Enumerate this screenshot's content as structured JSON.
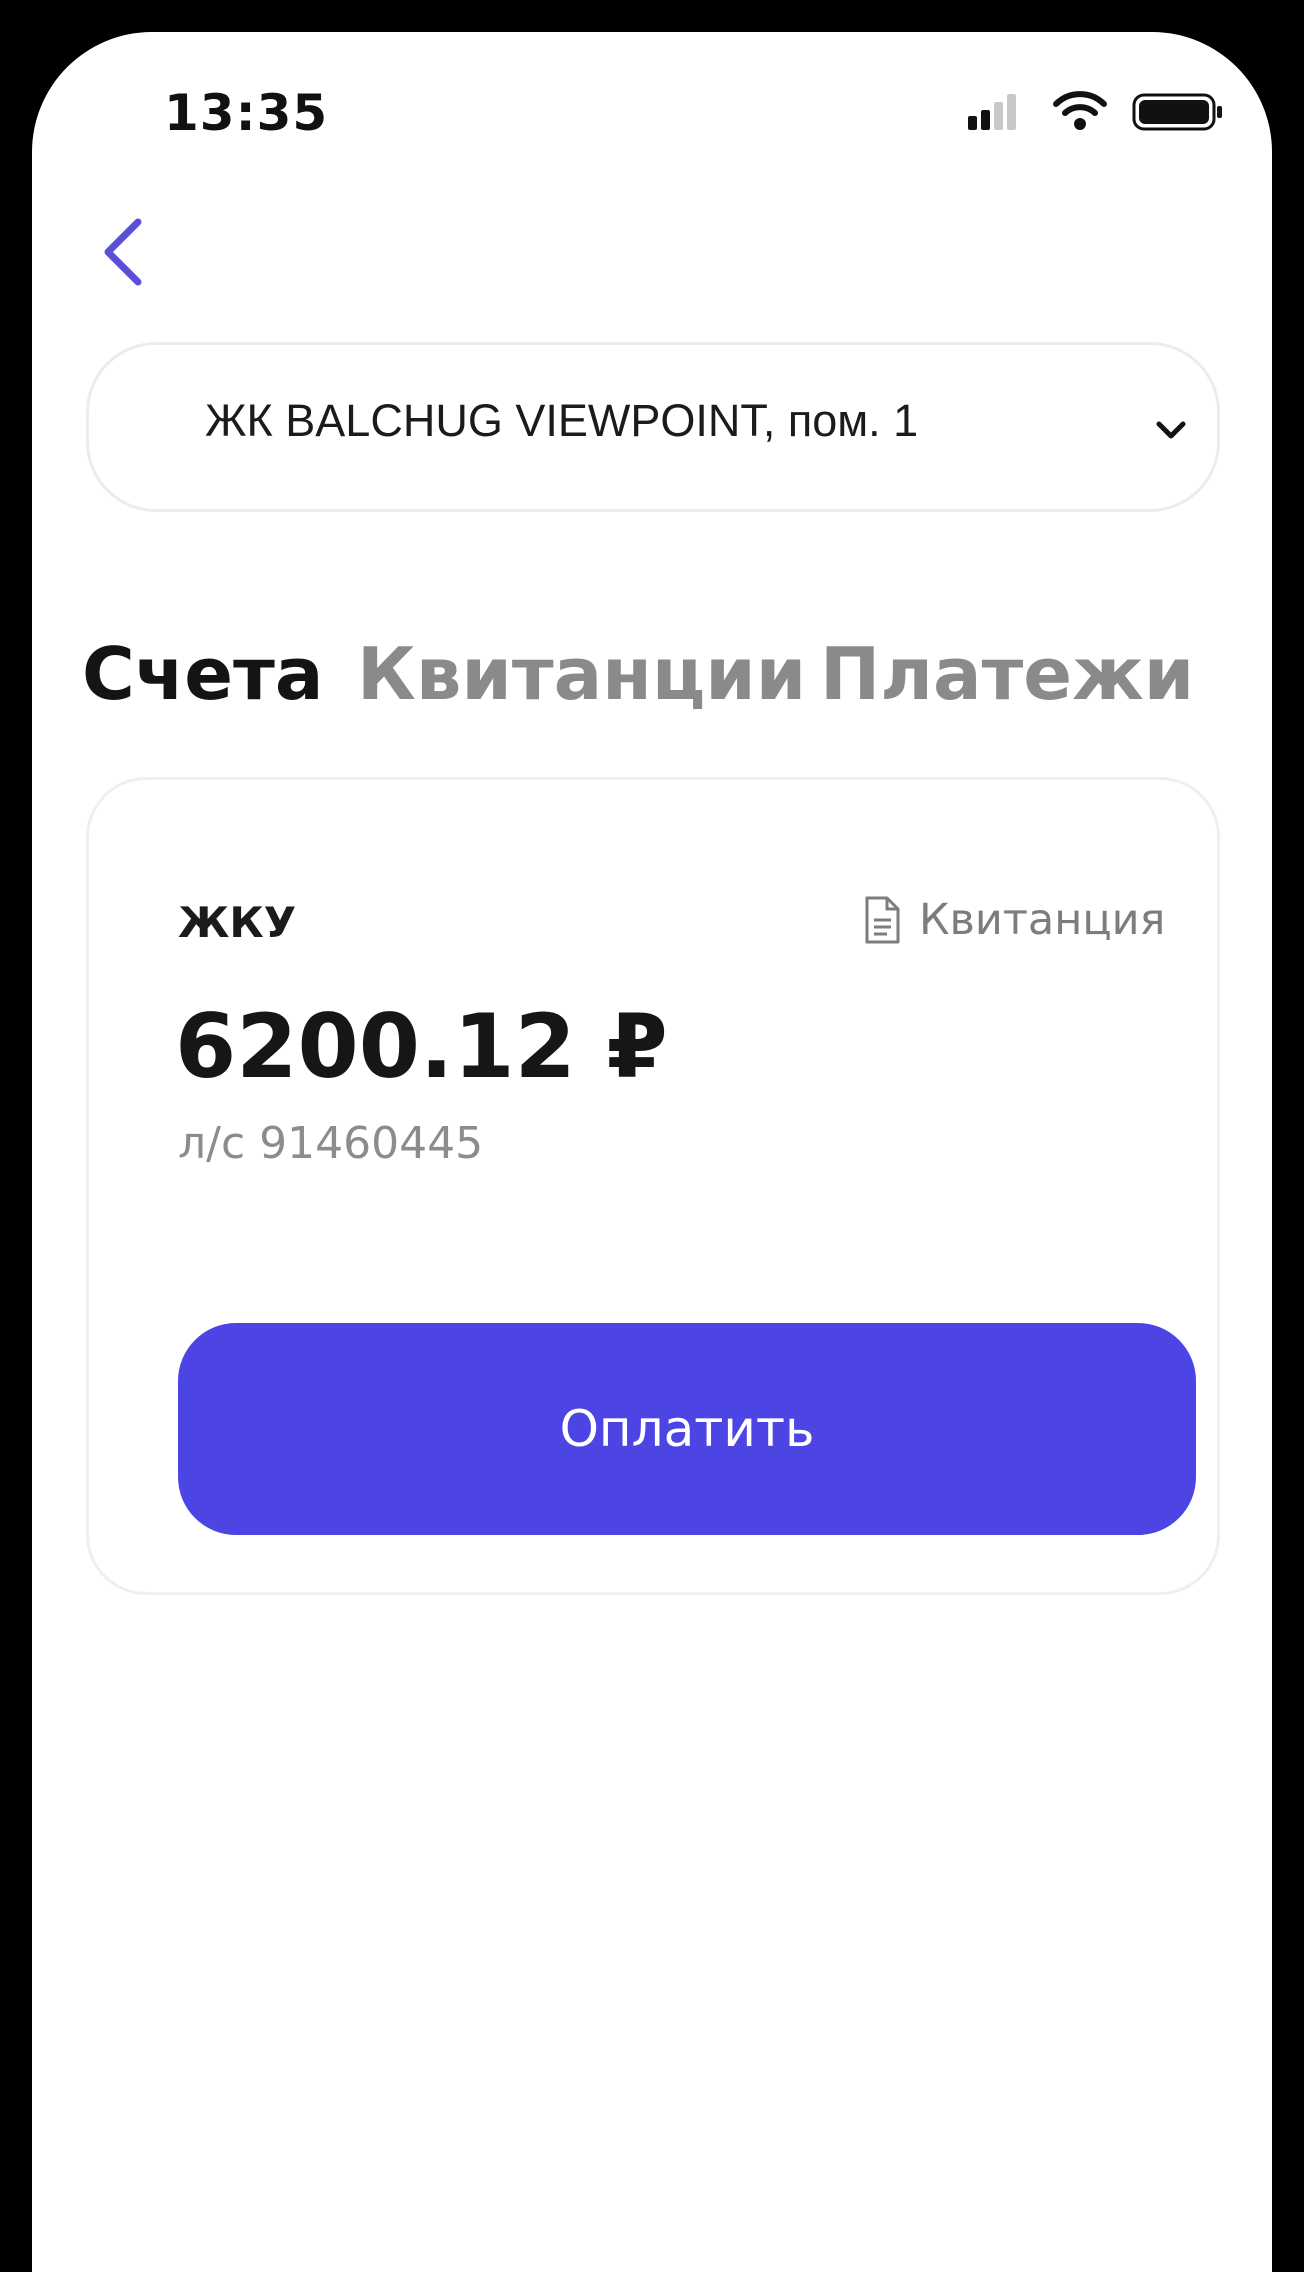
{
  "status_bar": {
    "time": "13:35",
    "icons": [
      "cellular-signal-icon",
      "wifi-icon",
      "battery-icon"
    ]
  },
  "header": {
    "back_icon": "chevron-left-icon"
  },
  "property_selector": {
    "value": "ЖК BALCHUG VIEWPOINT, пом. 1",
    "icon": "chevron-down-icon"
  },
  "tabs": [
    {
      "label": "Счета",
      "active": true
    },
    {
      "label": "Квитанции",
      "active": false
    },
    {
      "label": "Платежи",
      "active": false
    }
  ],
  "account_card": {
    "service": "ЖКУ",
    "receipt_label": "Квитанция",
    "receipt_icon": "document-icon",
    "amount": "6200.12 ₽",
    "account_number": "л/с 91460445",
    "pay_label": "Оплатить"
  },
  "colors": {
    "accent": "#4d45e3",
    "back_icon": "#5a4fd6",
    "text_primary": "#141414",
    "text_secondary": "#8a8a8a"
  }
}
